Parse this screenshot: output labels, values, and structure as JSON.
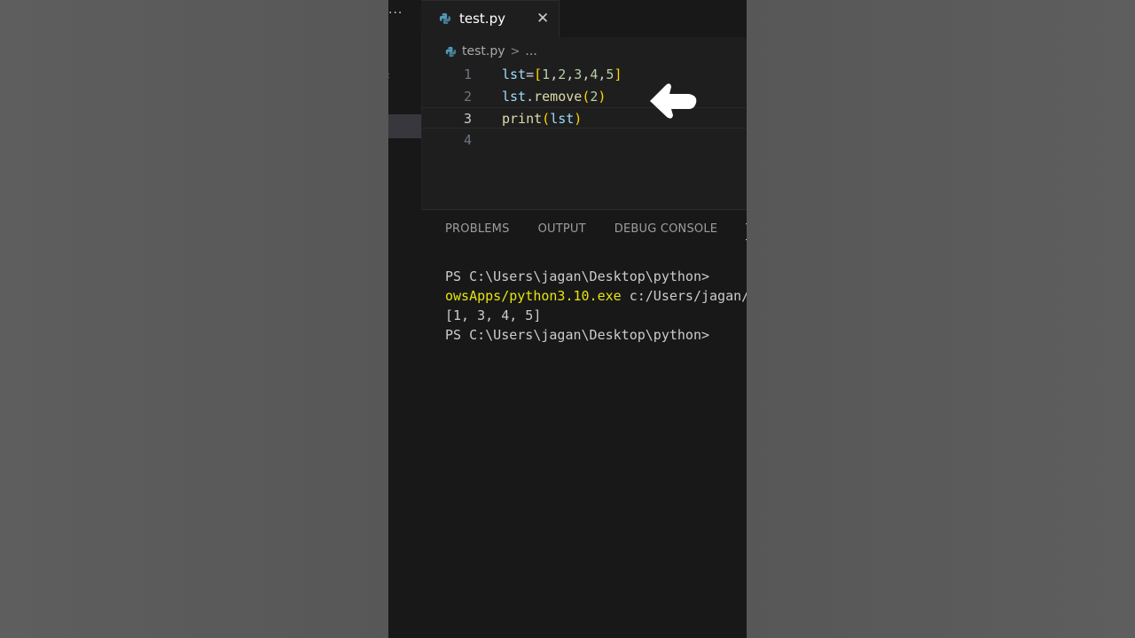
{
  "window": {
    "more_label": "···"
  },
  "tab": {
    "label": "test.py",
    "close_glyph": "✕",
    "icon": "python-file-icon"
  },
  "breadcrumb": {
    "file": "test.py",
    "separator": ">",
    "ellipsis": "..."
  },
  "editor": {
    "lines": [
      {
        "number": "1",
        "tokens": [
          {
            "t": "lst",
            "c": "var"
          },
          {
            "t": "=",
            "c": "op"
          },
          {
            "t": "[",
            "c": "br"
          },
          {
            "t": "1",
            "c": "num"
          },
          {
            "t": ",",
            "c": "op"
          },
          {
            "t": "2",
            "c": "num"
          },
          {
            "t": ",",
            "c": "op"
          },
          {
            "t": "3",
            "c": "num"
          },
          {
            "t": ",",
            "c": "op"
          },
          {
            "t": "4",
            "c": "num"
          },
          {
            "t": ",",
            "c": "op"
          },
          {
            "t": "5",
            "c": "num"
          },
          {
            "t": "]",
            "c": "br"
          }
        ]
      },
      {
        "number": "2",
        "tokens": [
          {
            "t": "lst",
            "c": "var"
          },
          {
            "t": ".",
            "c": "op"
          },
          {
            "t": "remove",
            "c": "fn"
          },
          {
            "t": "(",
            "c": "br"
          },
          {
            "t": "2",
            "c": "num"
          },
          {
            "t": ")",
            "c": "br"
          }
        ]
      },
      {
        "number": "3",
        "active": true,
        "tokens": [
          {
            "t": "print",
            "c": "fn"
          },
          {
            "t": "(",
            "c": "br"
          },
          {
            "t": "lst",
            "c": "var"
          },
          {
            "t": ")",
            "c": "br"
          }
        ]
      },
      {
        "number": "4",
        "tokens": []
      }
    ]
  },
  "panel": {
    "tabs": [
      "PROBLEMS",
      "OUTPUT",
      "DEBUG CONSOLE",
      "TERMINAL"
    ],
    "active_tab": 3,
    "terminal_lines": [
      {
        "segments": [
          {
            "t": "PS C:\\Users\\jagan\\Desktop\\python>",
            "c": ""
          }
        ]
      },
      {
        "segments": [
          {
            "t": "owsApps/python3.10.exe",
            "c": "yellow"
          },
          {
            "t": " c:/Users/jagan/Desktop/python/test.py",
            "c": ""
          }
        ]
      },
      {
        "segments": [
          {
            "t": "[1, 3, 4, 5]",
            "c": ""
          }
        ]
      },
      {
        "segments": [
          {
            "t": "PS C:\\Users\\jagan\\Desktop\\python>",
            "c": ""
          }
        ]
      }
    ]
  },
  "colors": {
    "editor_bg": "#1e1e1e",
    "panel_bg": "#181818",
    "string_yellow": "#e5e510",
    "bracket_gold": "#ffd700",
    "variable_blue": "#9cdcfe"
  }
}
